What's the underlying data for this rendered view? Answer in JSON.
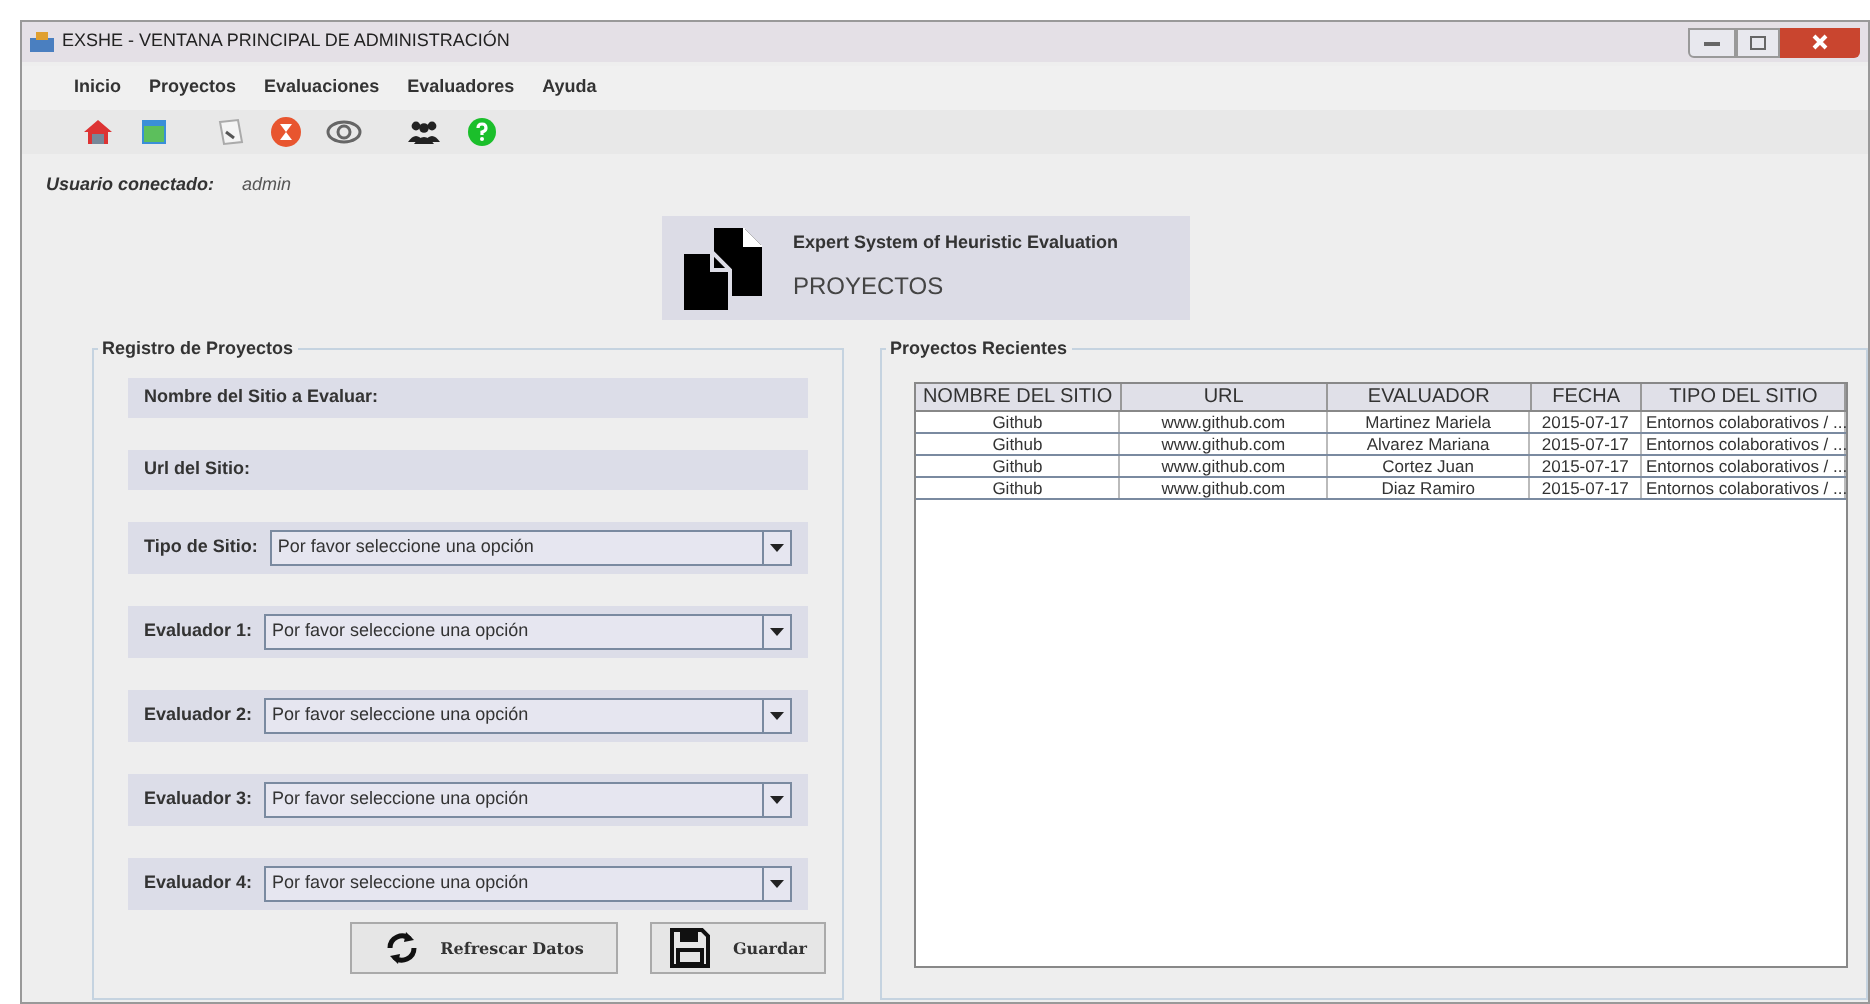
{
  "window": {
    "title": "EXSHE - VENTANA PRINCIPAL DE ADMINISTRACIÓN"
  },
  "menu": [
    "Inicio",
    "Proyectos",
    "Evaluaciones",
    "Evaluadores",
    "Ayuda"
  ],
  "toolbar": [
    {
      "kind": "home"
    },
    {
      "kind": "window"
    },
    {
      "kind": "note"
    },
    {
      "kind": "hourglass"
    },
    {
      "kind": "eye"
    },
    {
      "kind": "people"
    },
    {
      "kind": "help"
    }
  ],
  "user": {
    "label": "Usuario conectado:",
    "value": "admin"
  },
  "header": {
    "subtitle": "Expert System of Heuristic Evaluation",
    "title": "PROYECTOS"
  },
  "registro": {
    "legend": "Registro de Proyectos",
    "fields": [
      {
        "kind": "text",
        "label": "Nombre del Sitio a Evaluar:"
      },
      {
        "kind": "text",
        "label": "Url del Sitio:"
      },
      {
        "kind": "select",
        "label": "Tipo de Sitio:",
        "value": "Por favor seleccione una opción"
      },
      {
        "kind": "select",
        "label": "Evaluador 1:",
        "value": "Por favor seleccione una opción"
      },
      {
        "kind": "select",
        "label": "Evaluador 2:",
        "value": "Por favor seleccione una opción"
      },
      {
        "kind": "select",
        "label": "Evaluador 3:",
        "value": "Por favor seleccione una opción"
      },
      {
        "kind": "select",
        "label": "Evaluador 4:",
        "value": "Por favor seleccione una opción"
      }
    ],
    "buttons": [
      {
        "kind": "refresh",
        "label": "Refrescar Datos"
      },
      {
        "kind": "save",
        "label": "Guardar"
      }
    ]
  },
  "recientes": {
    "legend": "Proyectos Recientes",
    "table": {
      "columns": [
        "NOMBRE DEL SITIO",
        "URL",
        "EVALUADOR",
        "FECHA",
        "TIPO DEL SITIO"
      ],
      "rows": [
        [
          "Github",
          "www.github.com",
          "Martinez Mariela",
          "2015-07-17",
          "Entornos colaborativos / ..."
        ],
        [
          "Github",
          "www.github.com",
          "Alvarez Mariana",
          "2015-07-17",
          "Entornos colaborativos / ..."
        ],
        [
          "Github",
          "www.github.com",
          "Cortez Juan",
          "2015-07-17",
          "Entornos colaborativos / ..."
        ],
        [
          "Github",
          "www.github.com",
          "Diaz Ramiro",
          "2015-07-17",
          "Entornos colaborativos / ..."
        ]
      ]
    }
  }
}
